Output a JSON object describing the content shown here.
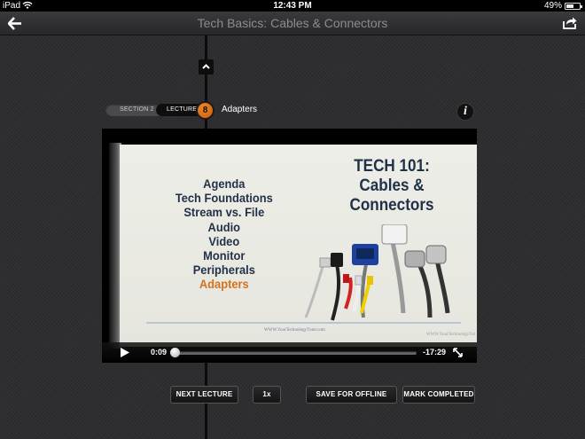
{
  "status_bar": {
    "carrier": "iPad",
    "time": "12:43 PM",
    "battery": "49%",
    "battery_level": 0.49
  },
  "nav": {
    "title": "Tech Basics: Cables & Connectors",
    "back_icon": "back-arrow-icon",
    "share_icon": "share-icon"
  },
  "breadcrumb": {
    "section_label": "SECTION 2",
    "lecture_label": "LECTURE",
    "lecture_number": "8",
    "lecture_title": "Adapters",
    "info_label": "i"
  },
  "slide": {
    "agenda": [
      "Agenda",
      "Tech Foundations",
      "Stream vs. File",
      "Audio",
      "Video",
      "Monitor",
      "Peripherals"
    ],
    "agenda_active": "Adapters",
    "title_line1": "TECH 101:",
    "title_line2": "Cables &",
    "title_line3": "Connectors",
    "url": "WWW.YourTechnologyTutor.com",
    "url_right": "WWW.YourTechnologyTut"
  },
  "player": {
    "current_time": "0:09",
    "remaining_time": "-17:29",
    "progress": 0.005
  },
  "actions": {
    "next_lecture": "NEXT LECTURE",
    "speed": "1x",
    "save_offline": "SAVE FOR OFFLINE",
    "mark_completed": "MARK COMPLETED"
  },
  "colors": {
    "accent_orange": "#e07a1f",
    "background": "#2e2e31",
    "agenda_text": "#223247",
    "agenda_active": "#d5711d"
  }
}
